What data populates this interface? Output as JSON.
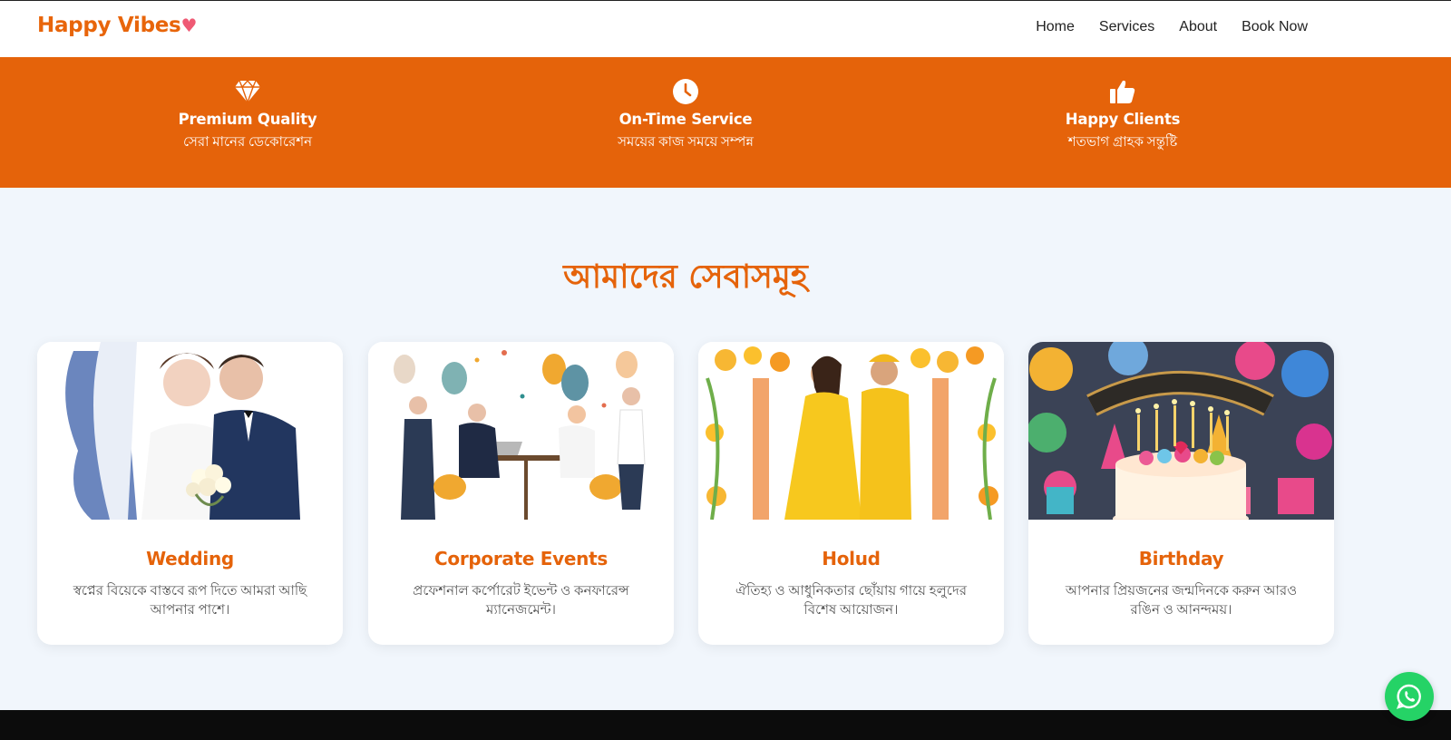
{
  "brand": {
    "name": "Happy Vibes",
    "heart": "♥"
  },
  "nav": {
    "items": [
      {
        "label": "Home"
      },
      {
        "label": "Services"
      },
      {
        "label": "About"
      },
      {
        "label": "Book Now"
      }
    ]
  },
  "features": [
    {
      "icon": "diamond-icon",
      "title": "Premium Quality",
      "subtitle": "সেরা মানের ডেকোরেশন"
    },
    {
      "icon": "clock-icon",
      "title": "On-Time Service",
      "subtitle": "সময়ের কাজ সময়ে সম্পন্ন"
    },
    {
      "icon": "thumbs-up-icon",
      "title": "Happy Clients",
      "subtitle": "শতভাগ গ্রাহক সন্তুষ্টি"
    }
  ],
  "services": {
    "heading": "আমাদের সেবাসমূহ",
    "cards": [
      {
        "image": "wedding-couple-image",
        "title": "Wedding",
        "description": "স্বপ্নের বিয়েকে বাস্তবে রূপ দিতে আমরা আছি আপনার পাশে।"
      },
      {
        "image": "corporate-meeting-image",
        "title": "Corporate Events",
        "description": "প্রফেশনাল কর্পোরেট ইভেন্ট ও কনফারেন্স ম্যানেজমেন্ট।"
      },
      {
        "image": "holud-ceremony-image",
        "title": "Holud",
        "description": "ঐতিহ্য ও আধুনিকতার ছোঁয়ায় গায়ে হলুদের বিশেষ আয়োজন।"
      },
      {
        "image": "birthday-cake-image",
        "title": "Birthday",
        "description": "আপনার প্রিয়জনের জন্মদিনকে করুন আরও রঙিন ও আনন্দময়।"
      }
    ]
  },
  "colors": {
    "accent": "#e5630a",
    "background": "#f1f6fc",
    "whatsapp": "#25d366",
    "footer": "#0c0c0c"
  },
  "floating": {
    "icon": "whatsapp-icon"
  }
}
